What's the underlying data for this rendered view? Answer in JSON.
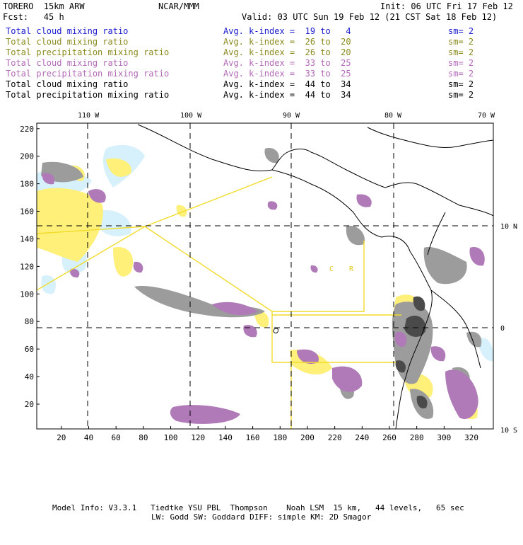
{
  "header": {
    "model": "TORERO  15km ARW",
    "center": "NCAR/MMM",
    "init": "Init: 06 UTC Fri 17 Feb 12",
    "fcst": "Fcst:   45 h",
    "valid": "Valid: 03 UTC Sun 19 Feb 12 (21 CST Sat 18 Feb 12)"
  },
  "legend": [
    {
      "field": "Total cloud mixing ratio",
      "kindex": "Avg. k-index =  19 to   4",
      "sm": "sm= 2",
      "color": "#1a1ad0"
    },
    {
      "field": "Total cloud mixing ratio",
      "kindex": "Avg. k-index =  26 to  20",
      "sm": "sm= 2",
      "color": "#8a8a1e"
    },
    {
      "field": "Total precipitation mixing ratio",
      "kindex": "Avg. k-index =  26 to  20",
      "sm": "sm= 2",
      "color": "#8a8a1e"
    },
    {
      "field": "Total cloud mixing ratio",
      "kindex": "Avg. k-index =  33 to  25",
      "sm": "sm= 2",
      "color": "#b36ab8"
    },
    {
      "field": "Total precipitation mixing ratio",
      "kindex": "Avg. k-index =  33 to  25",
      "sm": "sm= 2",
      "color": "#b36ab8"
    },
    {
      "field": "Total cloud mixing ratio",
      "kindex": "Avg. k-index =  44 to  34",
      "sm": "sm= 2",
      "color": "#000000"
    },
    {
      "field": "Total precipitation mixing ratio",
      "kindex": "Avg. k-index =  44 to  34",
      "sm": "sm= 2",
      "color": "#000000"
    }
  ],
  "map": {
    "lon_labels": [
      "110 W",
      "100 W",
      "90 W",
      "80 W",
      "70 W"
    ],
    "lat_labels": [
      "10 N",
      "0",
      "10 S"
    ],
    "y_ticks": [
      "220",
      "200",
      "180",
      "160",
      "140",
      "120",
      "100",
      "80",
      "60",
      "40",
      "20"
    ],
    "x_ticks": [
      "20",
      "40",
      "60",
      "80",
      "100",
      "120",
      "140",
      "160",
      "180",
      "200",
      "220",
      "240",
      "260",
      "280",
      "300",
      "320"
    ],
    "region_letters": [
      "C",
      "R"
    ],
    "colors": {
      "light_blue": "#d6f1fb",
      "yellow": "#fff07a",
      "purple": "#b07ab8",
      "gray": "#9c9c9c",
      "dark": "#4a4a4a",
      "box": "#f2dc2c",
      "grid": "#000000"
    }
  },
  "footer": {
    "line1": "Model Info: V3.3.1   Tiedtke YSU PBL  Thompson    Noah LSM  15 km,   44 levels,   65 sec",
    "line2": "LW: Godd SW: Goddard DIFF: simple KM: 2D Smagor"
  }
}
